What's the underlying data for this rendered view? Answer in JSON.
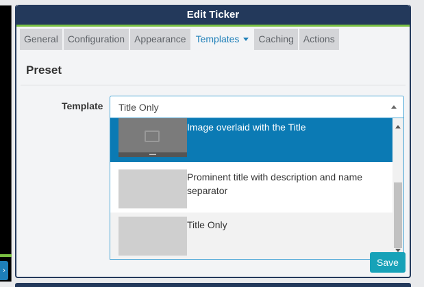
{
  "panel": {
    "title": "Edit Ticker"
  },
  "tabs": [
    {
      "label": "General",
      "active": false
    },
    {
      "label": "Configuration",
      "active": false
    },
    {
      "label": "Appearance",
      "active": false
    },
    {
      "label": "Templates",
      "active": true
    },
    {
      "label": "Caching",
      "active": false
    },
    {
      "label": "Actions",
      "active": false
    }
  ],
  "section": {
    "title": "Preset"
  },
  "template_field": {
    "label": "Template",
    "selected": "Title Only",
    "options": [
      {
        "label": "Image overlaid with the Title",
        "highlighted": true
      },
      {
        "label": "Prominent title with description and name separator",
        "highlighted": false
      },
      {
        "label": "Title Only",
        "highlighted": false
      }
    ]
  },
  "buttons": {
    "save": "Save"
  },
  "colors": {
    "header": "#23395b",
    "accent": "#1e7fb8",
    "highlight": "#0b7ab4",
    "green": "#7ac142",
    "save": "#17a2b8"
  },
  "icons": {
    "image_placeholder": "image-icon"
  }
}
